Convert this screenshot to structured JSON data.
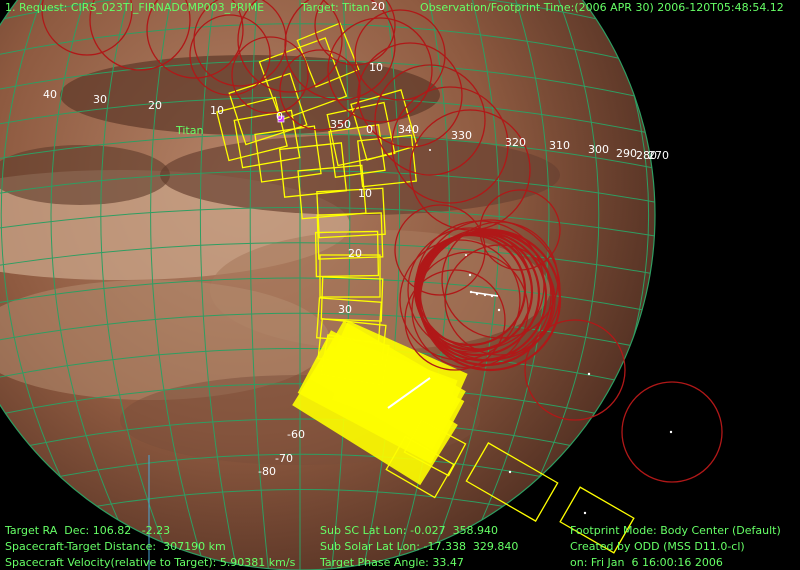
{
  "header": {
    "request": "1. Request: CIRS_023TI_FIRNADCMP003_PRIME",
    "target": "Target: Titan",
    "obs_time": "Observation/Footprint Time:(2006 APR 30) 2006-120T05:48:54.12"
  },
  "target_label": "Titan",
  "grid_labels": {
    "top": [
      "20",
      "10",
      "0",
      "350",
      "340",
      "330",
      "320",
      "310",
      "300",
      "290",
      "280",
      "270"
    ],
    "left": [
      "40",
      "30",
      "20",
      "10"
    ],
    "lat": [
      "10",
      "20",
      "30",
      "-60",
      "-70",
      "-80"
    ]
  },
  "footer": {
    "ra_dec": "Target RA  Dec: 106.82   -2.23",
    "distance": "Spacecraft-Target Distance:  307190 km",
    "velocity": "Spacecraft Velocity(relative to Target): 5.90381 km/s",
    "sub_sc": "Sub SC Lat Lon: -0.027  358.940",
    "sub_solar": "Sub Solar Lat Lon: -17.338  329.840",
    "phase": "Target Phase Angle: 33.47",
    "mode": "Footprint Mode: Body Center (Default)",
    "created": "Created by ODD (MSS D11.0-cl)",
    "date": "on: Fri Jan  6 16:00:16 2006"
  },
  "colors": {
    "hud_green": "#66ff66",
    "grid": "#2e9e62",
    "footprint_yellow": "#ffff00",
    "circle_red": "#b01818",
    "planet_base": "#8e5a40"
  }
}
